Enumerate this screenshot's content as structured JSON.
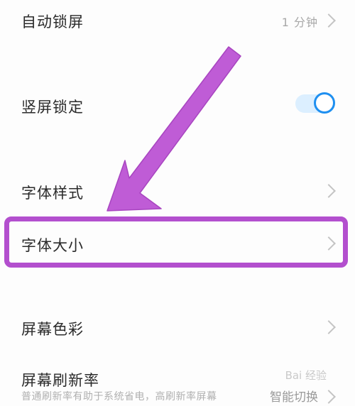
{
  "settings": {
    "auto_lock": {
      "label": "自动锁屏",
      "value": "1 分钟"
    },
    "portrait_lock": {
      "label": "竖屏锁定",
      "enabled": true
    },
    "font_style": {
      "label": "字体样式"
    },
    "font_size": {
      "label": "字体大小"
    },
    "screen_color": {
      "label": "屏幕色彩"
    },
    "refresh_rate": {
      "label": "屏幕刷新率",
      "description": "普通刷新率有助于系统省电，高刷新率屏幕",
      "value": "智能切换"
    }
  },
  "annotation": {
    "highlight_color": "#b34fce"
  },
  "watermark": {
    "text": "Bai 经验"
  },
  "colors": {
    "toggle_accent": "#1e8ff0",
    "toggle_track": "#dcefff",
    "chevron": "#c4c4c4"
  }
}
